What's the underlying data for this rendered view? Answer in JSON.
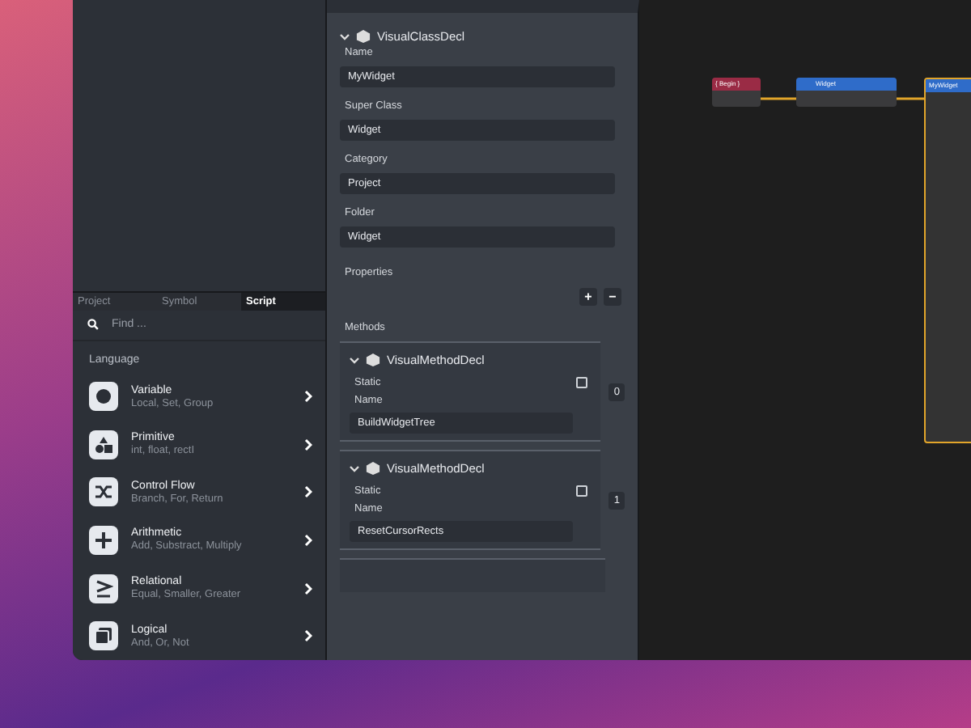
{
  "sidebar": {
    "tabs": [
      {
        "label": "Project",
        "selected": false
      },
      {
        "label": "Symbol",
        "selected": false
      },
      {
        "label": "Script",
        "selected": true
      }
    ],
    "search": {
      "placeholder": "Find ..."
    },
    "section": "Language",
    "items": [
      {
        "kind": "variable",
        "title": "Variable",
        "subtitle": "Local, Set, Group"
      },
      {
        "kind": "primitive",
        "title": "Primitive",
        "subtitle": "int, float, rectI"
      },
      {
        "kind": "flow",
        "title": "Control Flow",
        "subtitle": "Branch, For, Return"
      },
      {
        "kind": "arithmetic",
        "title": "Arithmetic",
        "subtitle": "Add, Substract, Multiply"
      },
      {
        "kind": "relational",
        "title": "Relational",
        "subtitle": "Equal, Smaller, Greater"
      },
      {
        "kind": "logical",
        "title": "Logical",
        "subtitle": "And, Or, Not"
      }
    ]
  },
  "inspector": {
    "title": "VisualClassDecl",
    "fields": [
      {
        "label": "Name",
        "value": "MyWidget"
      },
      {
        "label": "Super Class",
        "value": "Widget"
      },
      {
        "label": "Category",
        "value": "Project"
      },
      {
        "label": "Folder",
        "value": "Widget"
      }
    ],
    "properties_label": "Properties",
    "add": "+",
    "remove": "−",
    "methods_label": "Methods",
    "methods": [
      {
        "title": "VisualMethodDecl",
        "static_label": "Static",
        "static": false,
        "name_label": "Name",
        "name": "BuildWidgetTree",
        "index": "0"
      },
      {
        "title": "VisualMethodDecl",
        "static_label": "Static",
        "static": false,
        "name_label": "Name",
        "name": "ResetCursorRects",
        "index": "1"
      }
    ]
  },
  "canvas": {
    "nodes": [
      {
        "kind": "event",
        "title": "{ Begin }"
      },
      {
        "kind": "call",
        "title": "Widget"
      },
      {
        "kind": "class",
        "title": "MyWidget"
      }
    ]
  }
}
